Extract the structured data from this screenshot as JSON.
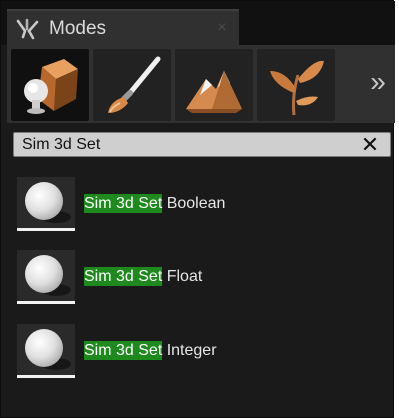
{
  "panel": {
    "title": "Modes",
    "close_glyph": "×",
    "icon": "modes-icon"
  },
  "modes": [
    {
      "name": "place",
      "icon": "cube-sphere-icon",
      "active": true
    },
    {
      "name": "paint",
      "icon": "paintbrush-icon",
      "active": false
    },
    {
      "name": "landscape",
      "icon": "mountain-icon",
      "active": false
    },
    {
      "name": "foliage",
      "icon": "leaf-icon",
      "active": false
    }
  ],
  "more_glyph": "»",
  "search": {
    "value": "Sim 3d Set",
    "clear_glyph": "✕"
  },
  "results": [
    {
      "highlight": "Sim 3d Set",
      "suffix": " Boolean"
    },
    {
      "highlight": "Sim 3d Set",
      "suffix": " Float"
    },
    {
      "highlight": "Sim 3d Set",
      "suffix": " Integer"
    }
  ],
  "colors": {
    "panel_bg": "#1a1a1a",
    "highlight": "#1e8a1e",
    "text": "#e6e6e6"
  }
}
